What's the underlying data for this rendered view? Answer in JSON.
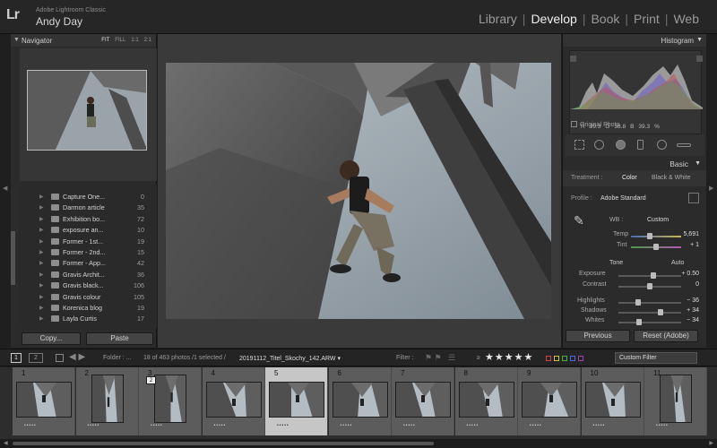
{
  "app": {
    "logo": "Lr",
    "product": "Adobe Lightroom Classic",
    "user": "Andy Day"
  },
  "modules": [
    {
      "label": "Library",
      "active": false
    },
    {
      "label": "Develop",
      "active": true
    },
    {
      "label": "Book",
      "active": false
    },
    {
      "label": "Print",
      "active": false
    },
    {
      "label": "Web",
      "active": false
    }
  ],
  "navigator": {
    "title": "Navigator",
    "zoom_options": [
      "FIT",
      "FILL",
      "1:1",
      "2:1"
    ]
  },
  "folders": [
    {
      "name": "Capture One...",
      "count": "0"
    },
    {
      "name": "Darmon article",
      "count": "35"
    },
    {
      "name": "Exhibition bo...",
      "count": "72"
    },
    {
      "name": "exposure an...",
      "count": "10"
    },
    {
      "name": "Former - 1st...",
      "count": "19"
    },
    {
      "name": "Former - 2nd...",
      "count": "15"
    },
    {
      "name": "Former - App...",
      "count": "42"
    },
    {
      "name": "Gravis Archit...",
      "count": "36"
    },
    {
      "name": "Gravis black...",
      "count": "106"
    },
    {
      "name": "Gravis colour",
      "count": "105"
    },
    {
      "name": "Korenica blog",
      "count": "19"
    },
    {
      "name": "Layla Curtis",
      "count": "17"
    }
  ],
  "left_buttons": {
    "copy": "Copy...",
    "paste": "Paste"
  },
  "histogram": {
    "title": "Histogram",
    "r_label": "R",
    "r_value": "39.3",
    "g_label": "G",
    "g_value": "38.8",
    "b_label": "B",
    "b_value": "39.3",
    "unit": "%",
    "original_photo": "Original Photo"
  },
  "basic": {
    "title": "Basic",
    "treatment_label": "Treatment :",
    "treatment_color": "Color",
    "treatment_bw": "Black & White",
    "profile_label": "Profile :",
    "profile_value": "Adobe Standard",
    "wb_label": "WB :",
    "wb_value": "Custom",
    "temp_label": "Temp",
    "temp_value": "5,691",
    "temp_level": 0.38,
    "tint_label": "Tint",
    "tint_value": "+ 1",
    "tint_level": 0.5,
    "tone_label": "Tone",
    "auto_label": "Auto",
    "exposure_label": "Exposure",
    "exposure_value": "+ 0.50",
    "exposure_level": 0.55,
    "contrast_label": "Contrast",
    "contrast_value": "0",
    "contrast_level": 0.5,
    "highlights_label": "Highlights",
    "highlights_value": "− 36",
    "highlights_level": 0.32,
    "shadows_label": "Shadows",
    "shadows_value": "+ 34",
    "shadows_level": 0.67,
    "whites_label": "Whites",
    "whites_value": "− 34",
    "whites_level": 0.33
  },
  "right_buttons": {
    "previous": "Previous",
    "reset": "Reset (Adobe)"
  },
  "filmstrip_toolbar": {
    "screen1": "1",
    "screen2": "2",
    "folder": "Folder : ...",
    "info": "18 of 463 photos /1 selected /",
    "filename": "20191112_Titel_Skochy_142.ARW ▾",
    "filter": "Filter :",
    "rating_op": "≥",
    "stars": "★★★★★",
    "custom_filter": "Custom Filter"
  },
  "filmstrip": [
    {
      "num": "1",
      "dots": "•••••"
    },
    {
      "num": "2",
      "dots": "•••••"
    },
    {
      "num": "3",
      "dots": "•••••",
      "badge": "2"
    },
    {
      "num": "4",
      "dots": "•••••"
    },
    {
      "num": "5",
      "dots": "•••••",
      "selected": true
    },
    {
      "num": "6",
      "dots": "•••••"
    },
    {
      "num": "7",
      "dots": "•••••"
    },
    {
      "num": "8",
      "dots": "•••••"
    },
    {
      "num": "9",
      "dots": "•••••"
    },
    {
      "num": "10",
      "dots": "•••••"
    },
    {
      "num": "11",
      "dots": "•••••"
    }
  ],
  "colors": {
    "panel": "#2b2b2b",
    "header": "#333333",
    "selected_cell": "#c6c6c6",
    "flags": [
      "#d04040",
      "#d0c040",
      "#40b040",
      "#4070d0",
      "#a040b0"
    ]
  }
}
